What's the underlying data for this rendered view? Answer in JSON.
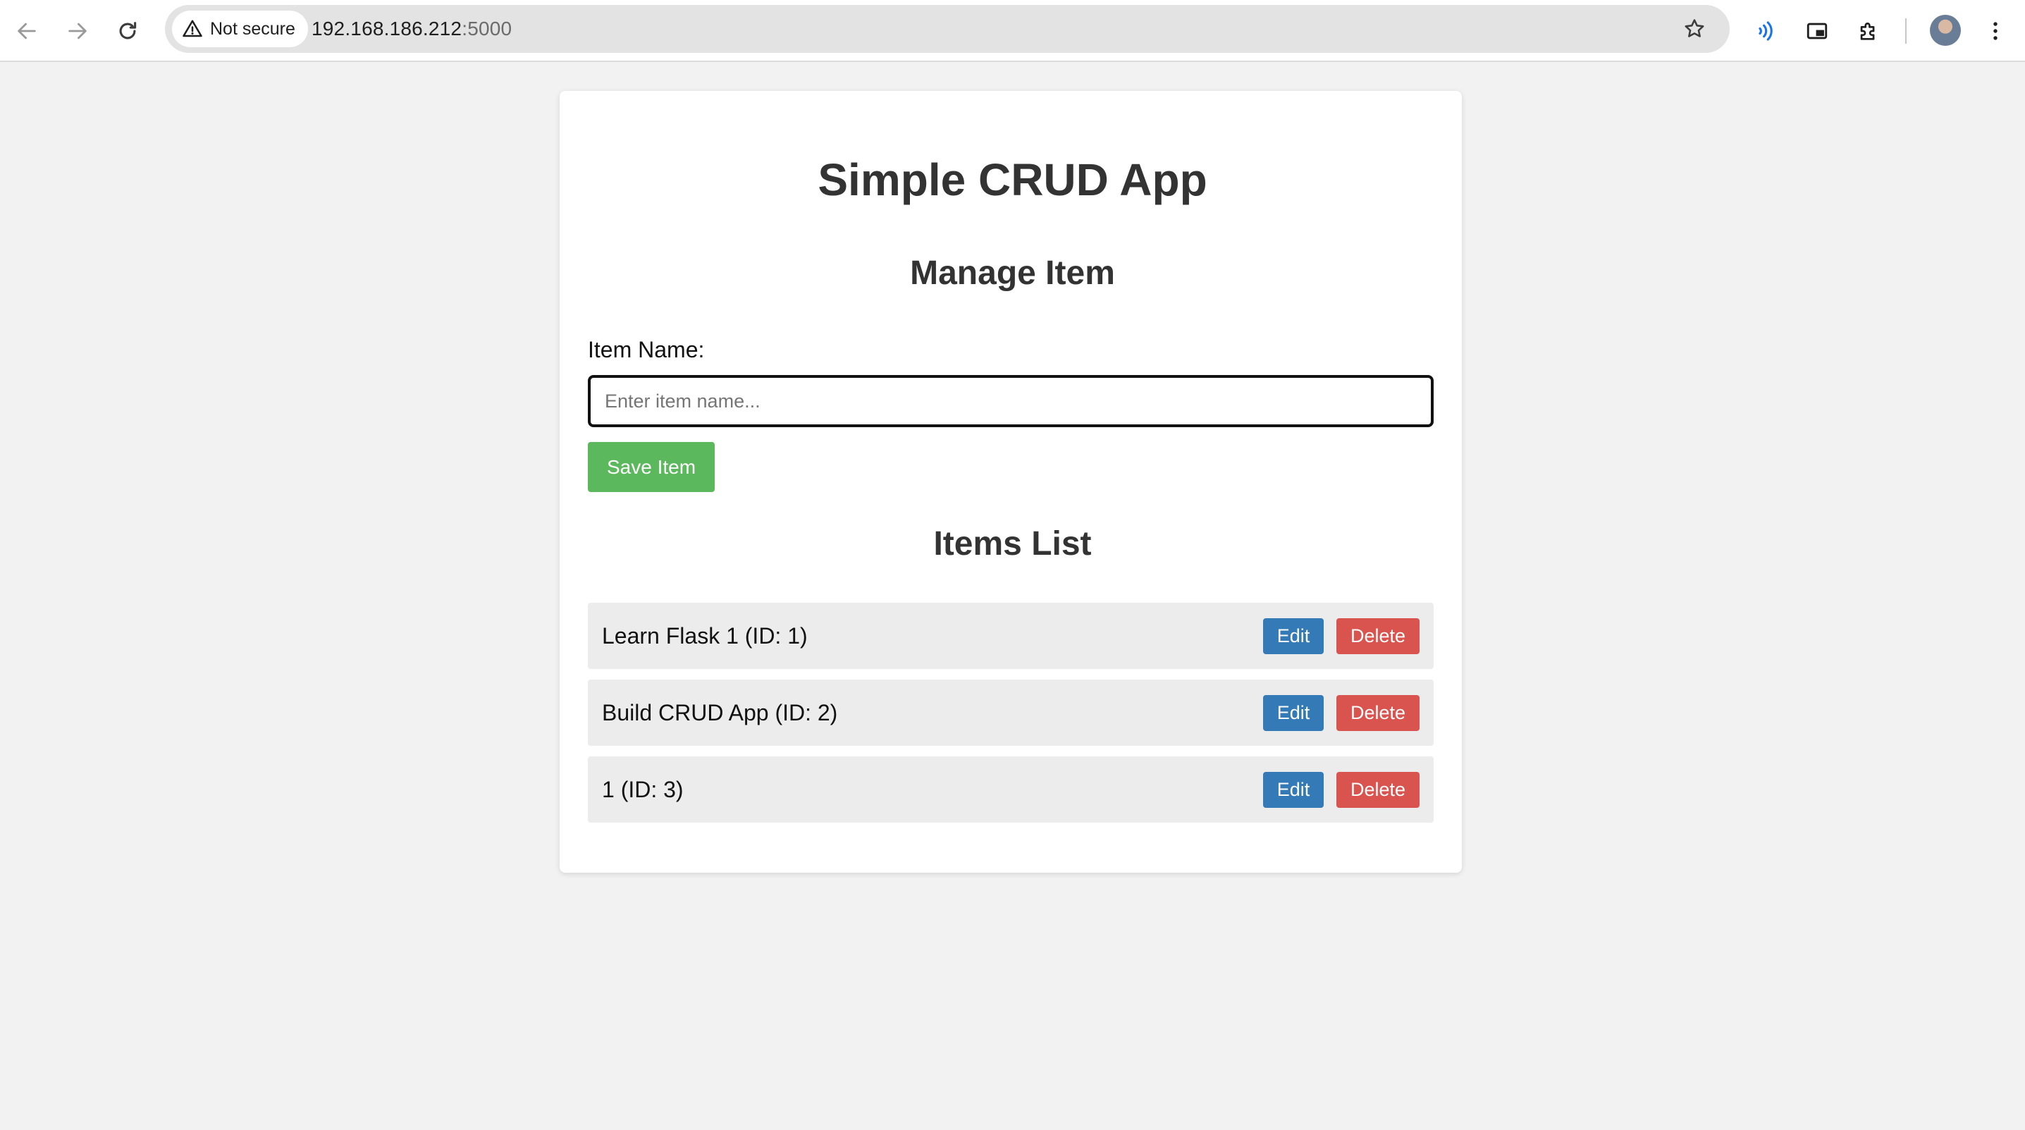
{
  "browser": {
    "security_label": "Not secure",
    "url_host": "192.168.186.212",
    "url_port": ":5000",
    "icons": {
      "back": "back-arrow-icon",
      "forward": "forward-arrow-icon",
      "reload": "reload-icon",
      "security": "warning-triangle-icon",
      "bookmark": "star-icon",
      "read_aloud": "read-aloud-icon",
      "pip": "picture-in-picture-icon",
      "extensions": "puzzle-icon",
      "menu": "kebab-menu-icon"
    }
  },
  "app": {
    "title": "Simple CRUD App",
    "manage_heading": "Manage Item",
    "field_label": "Item Name:",
    "input": {
      "value": "",
      "placeholder": "Enter item name..."
    },
    "save_label": "Save Item",
    "list_heading": "Items List",
    "items": [
      {
        "text": "Learn Flask 1 (ID: 1)",
        "edit_label": "Edit",
        "delete_label": "Delete"
      },
      {
        "text": "Build CRUD App (ID: 2)",
        "edit_label": "Edit",
        "delete_label": "Delete"
      },
      {
        "text": "1 (ID: 3)",
        "edit_label": "Edit",
        "delete_label": "Delete"
      }
    ]
  },
  "colors": {
    "page_background": "#f2f2f2",
    "save_button": "#5cb85c",
    "edit_button": "#337ab7",
    "delete_button": "#d9534f",
    "row_background": "#ececec",
    "read_aloud_accent": "#1a73e8"
  }
}
